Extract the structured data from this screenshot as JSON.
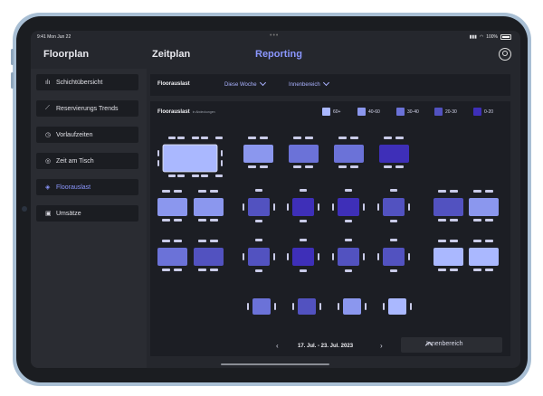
{
  "status_bar": {
    "time": "9:41  Mon Jun 22",
    "battery": "100%"
  },
  "nav": {
    "floorplan": "Floorplan",
    "zeitplan": "Zeitplan",
    "reporting": "Reporting",
    "user_icon": "user-circle-icon"
  },
  "sidebar": {
    "items": [
      {
        "label": "Schichtübersicht",
        "icon": "bar-chart-icon"
      },
      {
        "label": "Reservierungs Trends",
        "icon": "trend-chart-icon"
      },
      {
        "label": "Vorlaufzeiten",
        "icon": "clock-icon"
      },
      {
        "label": "Zeit am Tisch",
        "icon": "timer-icon"
      },
      {
        "label": "Floorauslast",
        "icon": "layers-icon"
      },
      {
        "label": "Umsätze",
        "icon": "cash-icon"
      }
    ]
  },
  "filter": {
    "title": "Floorauslast",
    "period": "Diese Woche",
    "area": "Innenbereich"
  },
  "panel": {
    "title": "Floorauslast",
    "subtitle": "in Abdeckungen"
  },
  "legend": [
    {
      "label": "60+",
      "color": "#aab8ff"
    },
    {
      "label": "40-60",
      "color": "#8b97ee"
    },
    {
      "label": "30-40",
      "color": "#6b72d8"
    },
    {
      "label": "20-30",
      "color": "#5252c0"
    },
    {
      "label": "0-20",
      "color": "#3e2fb8"
    }
  ],
  "footer": {
    "prev": "‹",
    "date_range": "17. Jul. - 23. Jul. 2023",
    "next": "›",
    "area_button": "Innenbereich"
  },
  "tables": [
    {
      "shape": "long",
      "level": 0,
      "seats": 10
    },
    {
      "shape": "rect",
      "level": 1,
      "seats": 4
    },
    {
      "shape": "rect",
      "level": 2,
      "seats": 4
    },
    {
      "shape": "rect",
      "level": 2,
      "seats": 4
    },
    {
      "shape": "rect",
      "level": 4,
      "seats": 4
    },
    {
      "shape": "rect",
      "level": 1,
      "seats": 4
    },
    {
      "shape": "rect",
      "level": 1,
      "seats": 4
    },
    {
      "shape": "square",
      "level": 3,
      "seats": 4
    },
    {
      "shape": "square",
      "level": 4,
      "seats": 4
    },
    {
      "shape": "square",
      "level": 4,
      "seats": 4
    },
    {
      "shape": "square",
      "level": 3,
      "seats": 4
    },
    {
      "shape": "rect",
      "level": 3,
      "seats": 4
    },
    {
      "shape": "rect",
      "level": 1,
      "seats": 4
    },
    {
      "shape": "rect",
      "level": 2,
      "seats": 4
    },
    {
      "shape": "rect",
      "level": 3,
      "seats": 4
    },
    {
      "shape": "square",
      "level": 3,
      "seats": 4
    },
    {
      "shape": "square",
      "level": 4,
      "seats": 4
    },
    {
      "shape": "square",
      "level": 3,
      "seats": 4
    },
    {
      "shape": "square",
      "level": 3,
      "seats": 4
    },
    {
      "shape": "rect",
      "level": 0,
      "seats": 4
    },
    {
      "shape": "rect",
      "level": 0,
      "seats": 4
    },
    {
      "shape": "small",
      "level": 2,
      "seats": 2
    },
    {
      "shape": "small",
      "level": 3,
      "seats": 2
    },
    {
      "shape": "small",
      "level": 1,
      "seats": 2
    },
    {
      "shape": "small",
      "level": 0,
      "seats": 2
    }
  ]
}
